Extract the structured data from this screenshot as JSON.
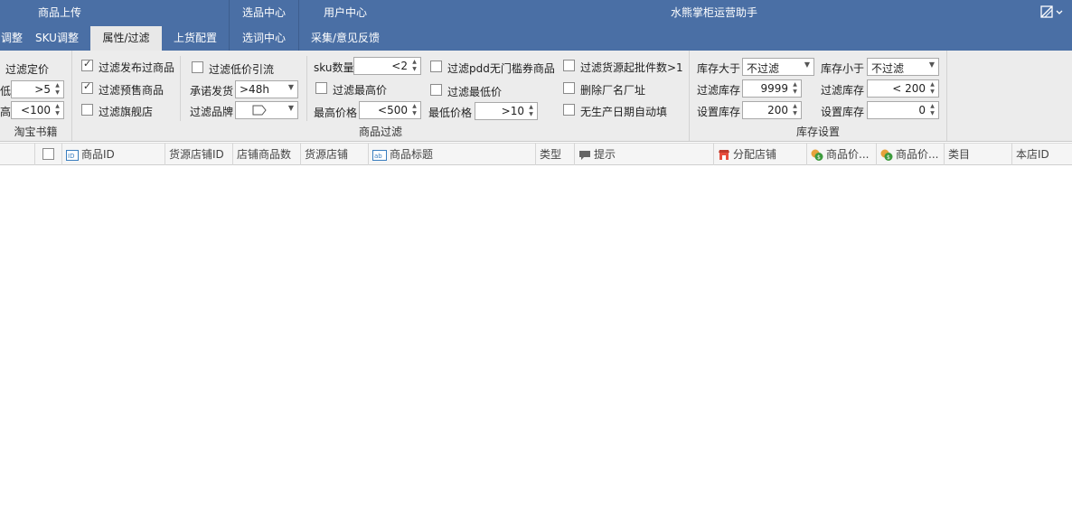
{
  "titlebar": {
    "app_title": "水熊掌柜运营助手",
    "groups": [
      {
        "label": "商品上传"
      },
      {
        "label": "选品中心"
      },
      {
        "label": "用户中心"
      }
    ],
    "tabs": [
      {
        "label": "调整"
      },
      {
        "label": "SKU调整"
      },
      {
        "label": "属性/过滤"
      },
      {
        "label": "上货配置"
      },
      {
        "label": "选词中心"
      },
      {
        "label": "采集/意见反馈"
      }
    ],
    "active_tab": "属性/过滤",
    "accent": "#4a6fa5"
  },
  "ribbon": {
    "group1": {
      "label": "淘宝书籍",
      "filter_price_label": "过滤定价",
      "low_label": "低",
      "low_value": ">5",
      "high_label": "高",
      "high_value": "<100"
    },
    "group2": {
      "label": "商品过滤",
      "cb_published": {
        "label": "过滤发布过商品",
        "checked": true
      },
      "cb_presale": {
        "label": "过滤预售商品",
        "checked": true
      },
      "cb_flagship": {
        "label": "过滤旗舰店",
        "checked": false
      },
      "cb_lowprice": {
        "label": "过滤低价引流",
        "checked": false
      },
      "promise_label": "承诺发货",
      "promise_value": ">48h",
      "brand_label": "过滤品牌",
      "brand_value": "",
      "sku_label": "sku数量",
      "sku_value": "<2",
      "cb_maxprice": {
        "label": "过滤最高价",
        "checked": false
      },
      "maxprice_label": "最高价格",
      "maxprice_value": "<500",
      "cb_pdd": {
        "label": "过滤pdd无门槛券商品",
        "checked": false
      },
      "cb_minprice": {
        "label": "过滤最低价",
        "checked": false
      },
      "minprice_label": "最低价格",
      "minprice_value": ">10",
      "cb_batch": {
        "label": "过滤货源起批件数>1",
        "checked": false
      },
      "cb_delfactory": {
        "label": "删除厂名厂址",
        "checked": false
      },
      "cb_noproddate": {
        "label": "无生产日期自动填",
        "checked": false
      }
    },
    "group3": {
      "label": "库存设置",
      "stock_gt_label": "库存大于",
      "stock_gt_value": "不过滤",
      "stock_lt_label": "库存小于",
      "stock_lt_value": "不过滤",
      "filter_stock1_label": "过滤库存",
      "filter_stock1_value": "9999",
      "filter_stock2_label": "过滤库存",
      "filter_stock2_value": "< 200",
      "set_stock1_label": "设置库存",
      "set_stock1_value": "200",
      "set_stock2_label": "设置库存",
      "set_stock2_value": "0"
    }
  },
  "grid": {
    "columns": [
      {
        "label": ""
      },
      {
        "label": ""
      },
      {
        "label": "商品ID",
        "icon": "id-icon"
      },
      {
        "label": "货源店铺ID"
      },
      {
        "label": "店铺商品数"
      },
      {
        "label": "货源店铺"
      },
      {
        "label": "商品标题",
        "icon": "ab-icon"
      },
      {
        "label": "类型"
      },
      {
        "label": "提示",
        "icon": "comment-icon"
      },
      {
        "label": "分配店铺",
        "icon": "store-icon"
      },
      {
        "label": "商品价...",
        "icon": "price-icon"
      },
      {
        "label": "商品价...",
        "icon": "price-icon"
      },
      {
        "label": "类目"
      },
      {
        "label": "本店ID"
      }
    ]
  }
}
